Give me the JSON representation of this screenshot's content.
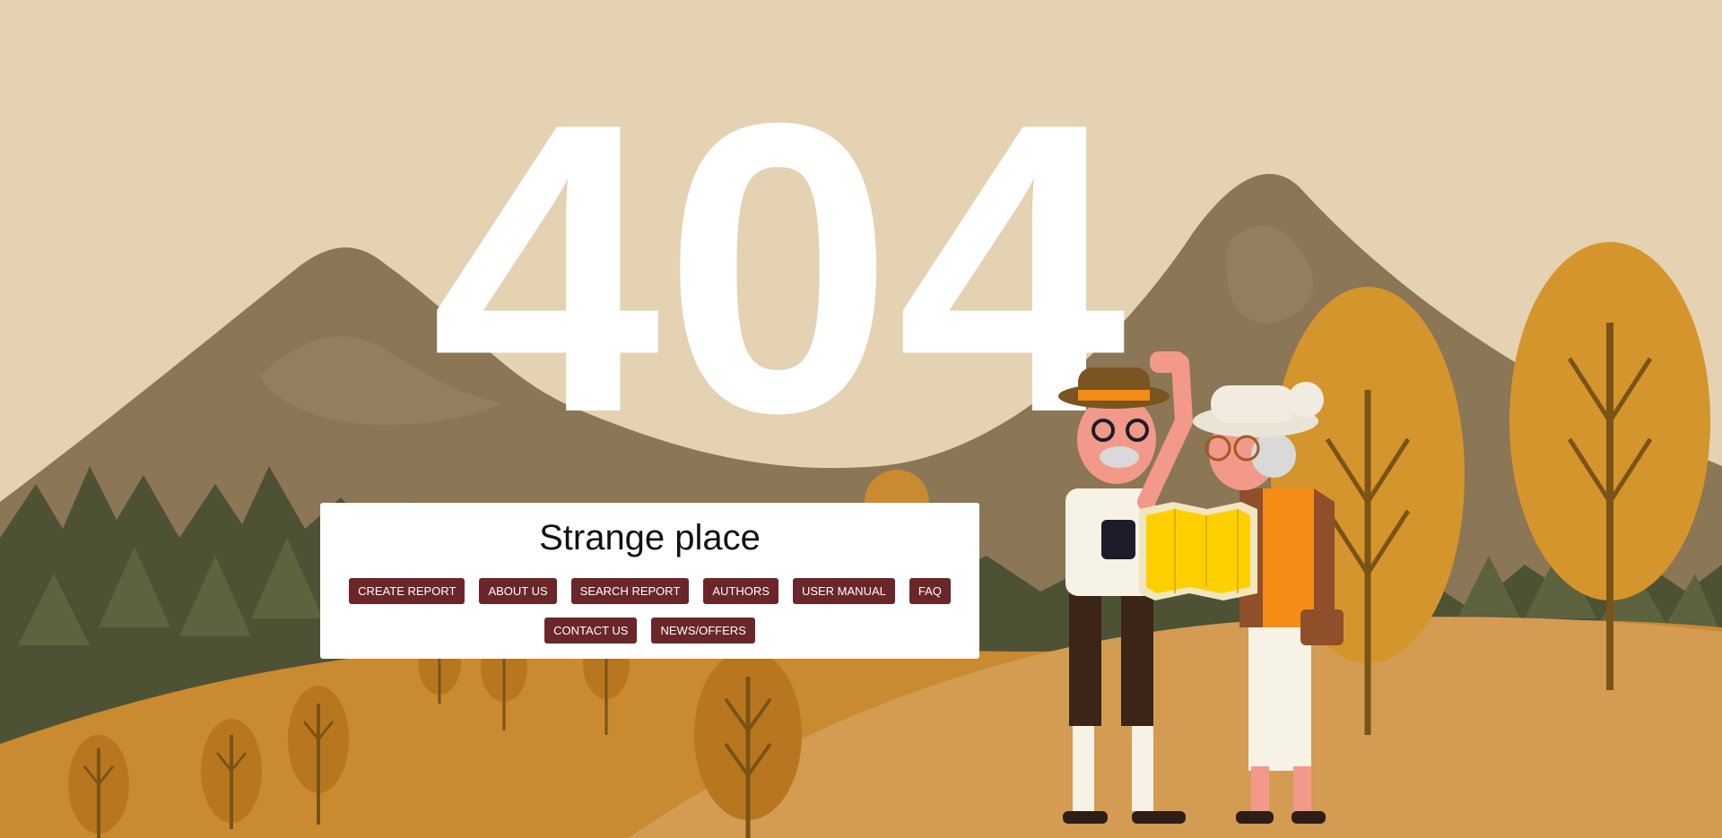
{
  "error": {
    "code": "404",
    "title": "Strange place"
  },
  "nav": {
    "row1": [
      {
        "label": "CREATE REPORT"
      },
      {
        "label": "ABOUT US"
      },
      {
        "label": "SEARCH REPORT"
      },
      {
        "label": "AUTHORS"
      },
      {
        "label": "USER MANUAL"
      },
      {
        "label": "FAQ"
      }
    ],
    "row2": [
      {
        "label": "CONTACT US"
      },
      {
        "label": "NEWS/OFFERS"
      }
    ]
  },
  "colors": {
    "sky": "#e5d2b3",
    "mountain": "#8b7656",
    "forest": "#4e5234",
    "hill": "#d49b52",
    "foreground": "#c98a30",
    "button": "#6a2629",
    "card": "#ffffff"
  },
  "illustration": {
    "subject": "two elderly hikers reading a map",
    "icons": [
      "mountain-icon",
      "pine-tree-icon",
      "autumn-tree-icon",
      "hiker-man-icon",
      "hiker-woman-icon",
      "map-icon"
    ]
  }
}
